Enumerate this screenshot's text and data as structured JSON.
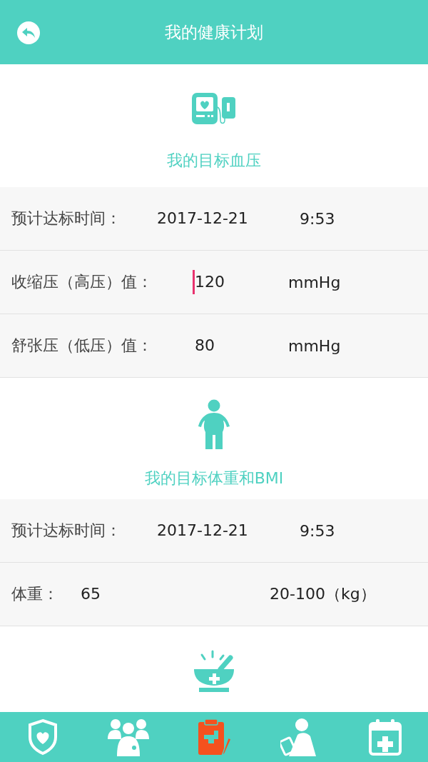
{
  "header": {
    "title": "我的健康计划"
  },
  "sections": [
    {
      "kind": "monitor",
      "title": "我的目标血压",
      "rows": [
        {
          "kind": "time",
          "label": "预计达标时间：",
          "value": "2017-12-21",
          "extra": "9:53"
        },
        {
          "kind": "measure",
          "label": "收缩压（高压）值：",
          "value": "120",
          "extra": "mmHg",
          "focused": true
        },
        {
          "kind": "measure",
          "label": "舒张压（低压）值：",
          "value": "80",
          "extra": "mmHg",
          "focused": false
        }
      ]
    },
    {
      "kind": "body",
      "title": "我的目标体重和BMI",
      "rows": [
        {
          "kind": "time",
          "label": "预计达标时间：",
          "value": "2017-12-21",
          "extra": "9:53"
        },
        {
          "kind": "range",
          "label": "体重：",
          "value": "65",
          "extra": "20-100（kg）"
        }
      ]
    },
    {
      "kind": "mortar"
    }
  ],
  "tabs": [
    {
      "kind": "shield",
      "selected": false
    },
    {
      "kind": "doctors",
      "selected": false
    },
    {
      "kind": "clipboard",
      "selected": true
    },
    {
      "kind": "reader",
      "selected": false
    },
    {
      "kind": "calendar",
      "selected": false
    }
  ]
}
